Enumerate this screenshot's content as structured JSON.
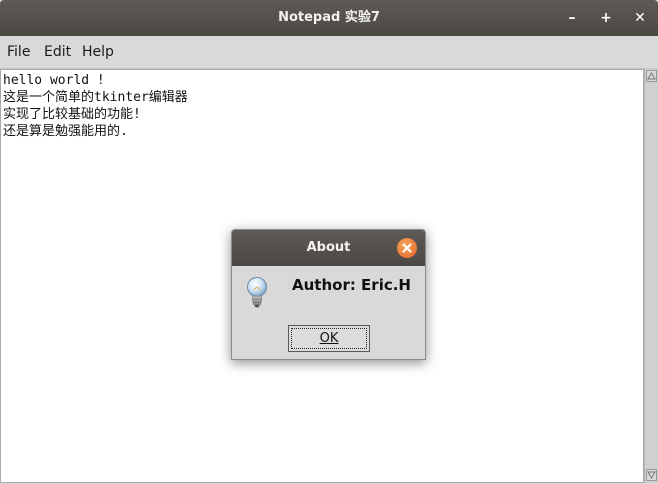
{
  "window": {
    "title": "Notepad 实验7",
    "controls": {
      "minimize": "–",
      "maximize": "+",
      "close": "✕"
    }
  },
  "menubar": {
    "items": [
      {
        "label": "File"
      },
      {
        "label": "Edit"
      },
      {
        "label": "Help"
      }
    ]
  },
  "editor": {
    "lines": [
      "hello world !",
      "这是一个简单的tkinter编辑器",
      "实现了比较基础的功能!",
      "还是算是勉强能用的."
    ]
  },
  "dialog": {
    "title": "About",
    "message": "Author: Eric.H",
    "ok_label": "OK",
    "icon": "info-lightbulb-icon"
  },
  "colors": {
    "titlebar": "#4b4743",
    "dialog_close": "#e4672a",
    "chrome": "#d9d9d9"
  }
}
